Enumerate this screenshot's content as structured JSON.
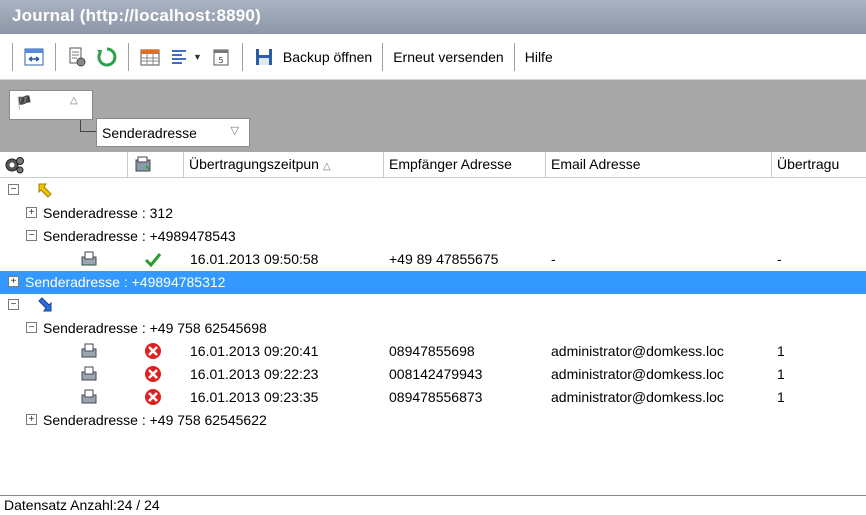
{
  "window": {
    "title": "Journal (http://localhost:8890)"
  },
  "toolbar": {
    "backup_label": "Backup öffnen",
    "resend_label": "Erneut versenden",
    "help_label": "Hilfe"
  },
  "group_panel": {
    "group_field": "Senderadresse"
  },
  "grid": {
    "columns": [
      {
        "label": "",
        "icon": "gear-cluster-icon"
      },
      {
        "label": "",
        "icon": "fax-status-icon"
      },
      {
        "label": "Übertragungszeitpun",
        "sorted": "asc"
      },
      {
        "label": "Empfänger Adresse"
      },
      {
        "label": "Email Adresse"
      },
      {
        "label": "Übertragu"
      }
    ],
    "outgoing_groups": [
      {
        "label": "Senderadresse : 312",
        "expanded": false
      },
      {
        "label": "Senderadresse : +4989478543",
        "expanded": true,
        "rows": [
          {
            "status": "ok",
            "time": "16.01.2013 09:50:58",
            "recipient": "+49 89 47855675",
            "email": "-",
            "transfer": "-"
          }
        ]
      },
      {
        "label": "Senderadresse : +49894785312",
        "expanded": false,
        "selected": true
      }
    ],
    "incoming_groups": [
      {
        "label": "Senderadresse : +49 758 62545698",
        "expanded": true,
        "rows": [
          {
            "status": "error",
            "time": "16.01.2013 09:20:41",
            "recipient": "08947855698",
            "email": "administrator@domkess.loc",
            "transfer": "1"
          },
          {
            "status": "error",
            "time": "16.01.2013 09:22:23",
            "recipient": "008142479943",
            "email": "administrator@domkess.loc",
            "transfer": "1"
          },
          {
            "status": "error",
            "time": "16.01.2013 09:23:35",
            "recipient": "089478556873",
            "email": "administrator@domkess.loc",
            "transfer": "1"
          }
        ]
      },
      {
        "label": "Senderadresse : +49 758 62545622",
        "expanded": false
      }
    ]
  },
  "status": {
    "record_count": "Datensatz Anzahl:24 / 24"
  },
  "colors": {
    "selection": "#3399ff",
    "titlebar": "#9aa4b4",
    "group_panel": "#a7a7a7",
    "ok": "#2a9a2a",
    "error": "#e02020",
    "outgoing_arrow": "#f5c400",
    "incoming_arrow": "#2a6ee0"
  }
}
